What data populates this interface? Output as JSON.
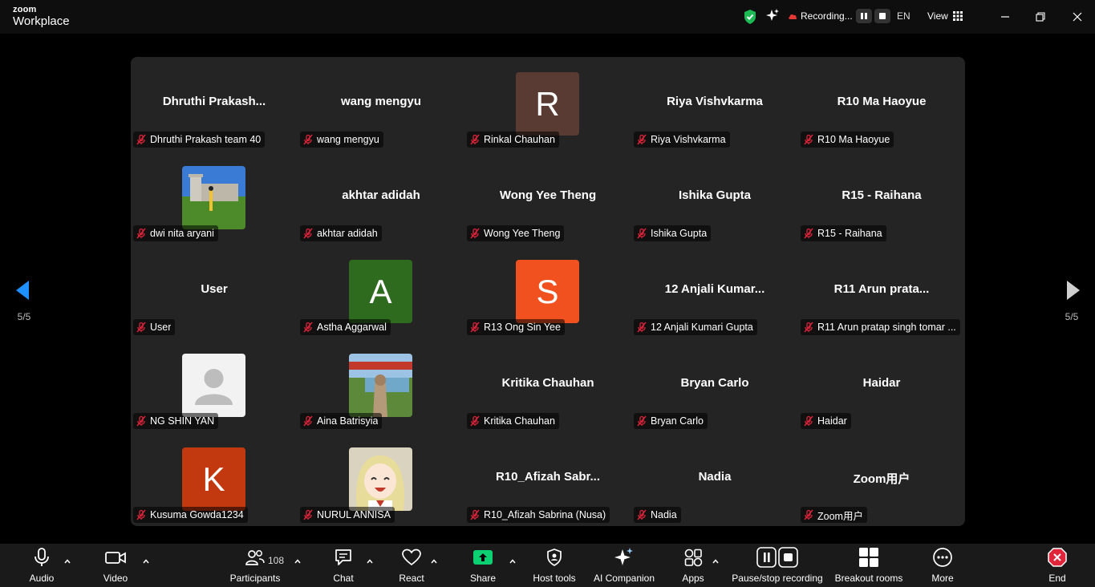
{
  "app": {
    "logo_top": "zoom",
    "logo_bottom": "Workplace"
  },
  "titlebar": {
    "recording_label": "Recording...",
    "language": "EN",
    "view_label": "View"
  },
  "pagination": {
    "left": "5/5",
    "right": "5/5"
  },
  "participants": [
    {
      "display": "Dhruthi  Prakash...",
      "name": "Dhruthi Prakash team 40"
    },
    {
      "display": "wang mengyu",
      "name": "wang mengyu"
    },
    {
      "avatar_letter": "R",
      "avatar_color": "#5a3b33",
      "name": "Rinkal Chauhan"
    },
    {
      "display": "Riya Vishvkarma",
      "name": "Riya Vishvkarma"
    },
    {
      "display": "R10 Ma Haoyue",
      "name": "R10 Ma Haoyue"
    },
    {
      "photo": "castle-photo",
      "name": "dwi nita aryani"
    },
    {
      "display": "akhtar adidah",
      "name": "akhtar adidah"
    },
    {
      "display": "Wong Yee Theng",
      "name": "Wong Yee Theng"
    },
    {
      "display": "Ishika Gupta",
      "name": "Ishika Gupta"
    },
    {
      "display": "R15 - Raihana",
      "name": "R15 - Raihana"
    },
    {
      "display": "User",
      "name": "User"
    },
    {
      "avatar_letter": "A",
      "avatar_color": "#2f6b1f",
      "name": "Astha Aggarwal"
    },
    {
      "avatar_letter": "S",
      "avatar_color": "#f0511f",
      "name": "R13 Ong Sin Yee"
    },
    {
      "display": "12  Anjali  Kumar...",
      "name": "12 Anjali Kumari Gupta"
    },
    {
      "display": "R11  Arun  prata...",
      "name": "R11 Arun pratap singh tomar ..."
    },
    {
      "photo": "default-person",
      "name": "NG SHIN YAN"
    },
    {
      "photo": "outdoor-photo",
      "name": "Aina Batrisyia"
    },
    {
      "display": "Kritika Chauhan",
      "name": "Kritika Chauhan"
    },
    {
      "display": "Bryan Carlo",
      "name": "Bryan Carlo"
    },
    {
      "display": "Haidar",
      "name": "Haidar"
    },
    {
      "avatar_letter": "K",
      "avatar_color": "#c2380f",
      "name": "Kusuma Gowda1234"
    },
    {
      "photo": "anime-photo",
      "name": "NURUL ANNISA"
    },
    {
      "display": "R10_Afizah  Sabr...",
      "name": "R10_Afizah Sabrina (Nusa)"
    },
    {
      "display": "Nadia",
      "name": "Nadia"
    },
    {
      "display": "Zoom用户",
      "name": "Zoom用户"
    }
  ],
  "toolbar": {
    "audio": "Audio",
    "video": "Video",
    "participants": "Participants",
    "participants_count": "108",
    "chat": "Chat",
    "react": "React",
    "share": "Share",
    "host_tools": "Host tools",
    "ai_companion": "AI Companion",
    "apps": "Apps",
    "pause_recording": "Pause/stop recording",
    "breakout_rooms": "Breakout rooms",
    "more": "More",
    "end": "End"
  },
  "colors": {
    "share_green": "#0bd173",
    "end_red": "#e0243a",
    "shield_green": "#1db954",
    "rec_red": "#e53935"
  }
}
